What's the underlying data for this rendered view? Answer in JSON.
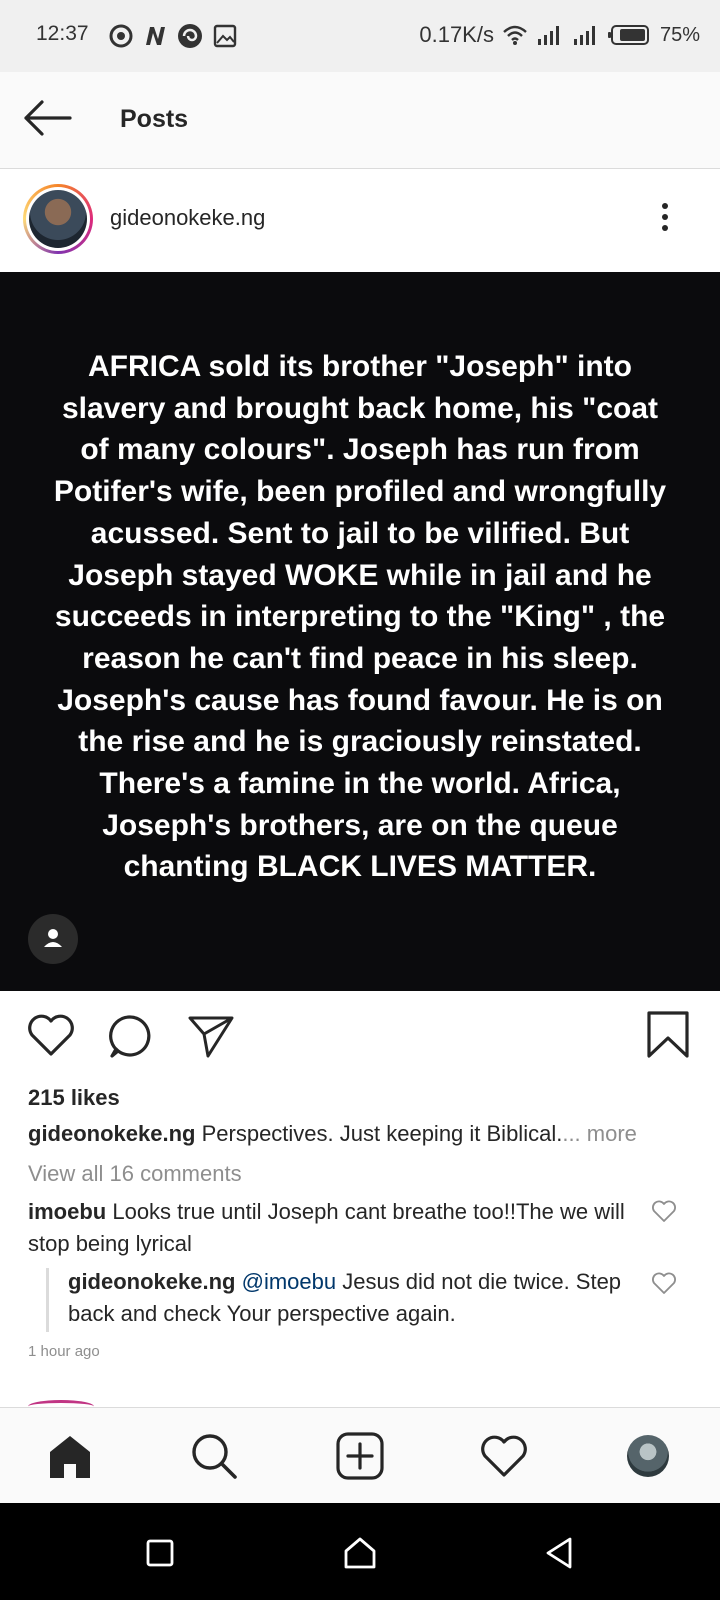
{
  "status_bar": {
    "time": "12:37",
    "net_speed": "0.17K/s",
    "battery": "75%",
    "icons": [
      "chrome-icon",
      "n-app-icon",
      "whirl-app-icon",
      "gallery-icon",
      "wifi-icon",
      "signal-icon",
      "signal-icon",
      "battery-icon"
    ]
  },
  "app_bar": {
    "title": "Posts"
  },
  "post": {
    "username": "gideonokeke.ng",
    "image_text": "AFRICA sold its brother \"Joseph\" into slavery and brought back home, his \"coat of many colours\". Joseph has run from Potifer's wife, been profiled and wrongfully acussed. Sent to jail to be vilified. But Joseph stayed WOKE while in jail and he succeeds in interpreting to the \"King\" , the reason he can't find peace in his sleep. Joseph's cause has found favour. He is on the rise and he is graciously reinstated. There's a famine in the world. Africa, Joseph's brothers, are on the queue chanting BLACK LIVES MATTER.",
    "likes": "215 likes",
    "caption_user": "gideonokeke.ng",
    "caption_text": " Perspectives. Just keeping it Biblical.",
    "caption_more": "... more",
    "view_all_comments": "View all 16 comments",
    "comments": [
      {
        "user": "imoebu",
        "text": " Looks true until Joseph cant breathe too!!The we will stop being lyrical"
      }
    ],
    "reply": {
      "user": "gideonokeke.ng",
      "mention": "@imoebu",
      "text": " Jesus did not die twice. Step back and check Your perspective again."
    },
    "time_ago": "1 hour ago"
  },
  "bottom_nav": [
    "home-icon",
    "search-icon",
    "add-post-icon",
    "activity-heart-icon",
    "profile-avatar"
  ],
  "colors": {
    "ig_gradient_pink": "#dd2a7b",
    "mention": "#00376b",
    "muted": "#8e8e8e"
  }
}
